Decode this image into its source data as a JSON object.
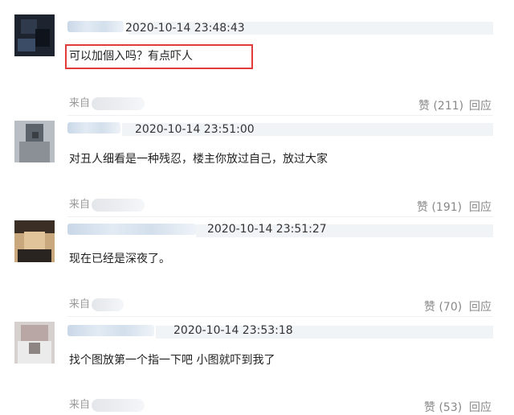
{
  "comments": [
    {
      "timestamp": "2020-10-14 23:48:43",
      "text": "可以加個入吗？有点吓人",
      "from_label": "来自",
      "like_label": "赞 (211)",
      "reply_label": "回应",
      "highlighted": true
    },
    {
      "timestamp": "2020-10-14 23:51:00",
      "text": "对丑人细看是一种残忍，楼主你放过自己，放过大家",
      "from_label": "来自",
      "like_label": "赞 (191)",
      "reply_label": "回应"
    },
    {
      "timestamp": "2020-10-14 23:51:27",
      "text": "现在已经是深夜了。",
      "from_label": "来自",
      "like_label": "赞 (70)",
      "reply_label": "回应"
    },
    {
      "timestamp": "2020-10-14 23:53:18",
      "text": "找个图放第一个指一下吧 小图就吓到我了",
      "from_label": "来自",
      "like_label": "赞 (53)",
      "reply_label": "回应"
    }
  ],
  "colors": {
    "highlight_border": "#e23b3b",
    "meta_text": "#999999",
    "action_text": "#888888"
  }
}
